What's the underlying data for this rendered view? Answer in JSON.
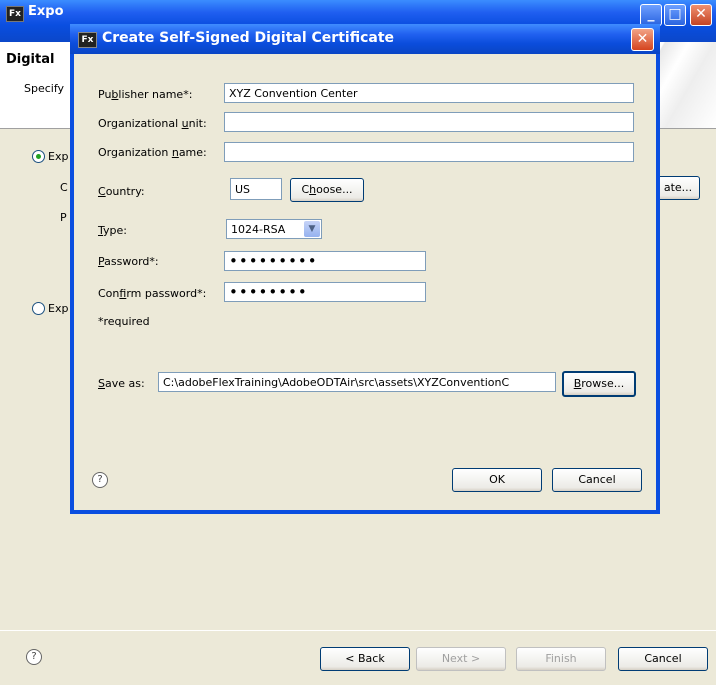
{
  "background_window": {
    "title": "Expo",
    "heading": "Digital",
    "subtitle": "Specify",
    "radio1_label": "Exp",
    "radio1_sub1": "C",
    "radio1_sub2": "P",
    "radio2_label": "Exp",
    "create_button_fragment": "ate...",
    "back_label": "< Back",
    "next_label": "Next >",
    "finish_label": "Finish",
    "cancel_label": "Cancel",
    "help_glyph": "?"
  },
  "dialog": {
    "title": "Create Self-Signed Digital Certificate",
    "close_glyph": "✕",
    "fx_badge": "Fx",
    "publisher_name": {
      "label_a": "Pu",
      "label_u": "b",
      "label_b": "lisher name*:",
      "value": "XYZ Convention Center"
    },
    "organizational_unit": {
      "label_a": "Organizational ",
      "label_u": "u",
      "label_b": "nit:",
      "value": ""
    },
    "organization_name": {
      "label_a": "Organization ",
      "label_u": "n",
      "label_b": "ame:",
      "value": ""
    },
    "country": {
      "label_a": "",
      "label_u": "C",
      "label_b": "ountry:",
      "value": "US",
      "choose_a": "C",
      "choose_u": "h",
      "choose_b": "oose..."
    },
    "type": {
      "label_a": "",
      "label_u": "T",
      "label_b": "ype:",
      "value": "1024-RSA"
    },
    "password": {
      "label_a": "",
      "label_u": "P",
      "label_b": "assword*:",
      "value": "•••••••••"
    },
    "confirm_password": {
      "label_a": "Con",
      "label_u": "f",
      "label_b": "irm password*:",
      "value": "••••••••"
    },
    "required_note": "*required",
    "save_as": {
      "label_a": "",
      "label_u": "S",
      "label_b": "ave as:",
      "value": "C:\\adobeFlexTraining\\AdobeODTAir\\src\\assets\\XYZConventionC",
      "browse_a": "",
      "browse_u": "B",
      "browse_b": "rowse..."
    },
    "ok_label": "OK",
    "cancel_label": "Cancel",
    "help_glyph": "?"
  },
  "colors": {
    "titlebar_blue": "#0a4ee0",
    "dialog_bg": "#ece9d8",
    "close_red": "#d5441f"
  }
}
